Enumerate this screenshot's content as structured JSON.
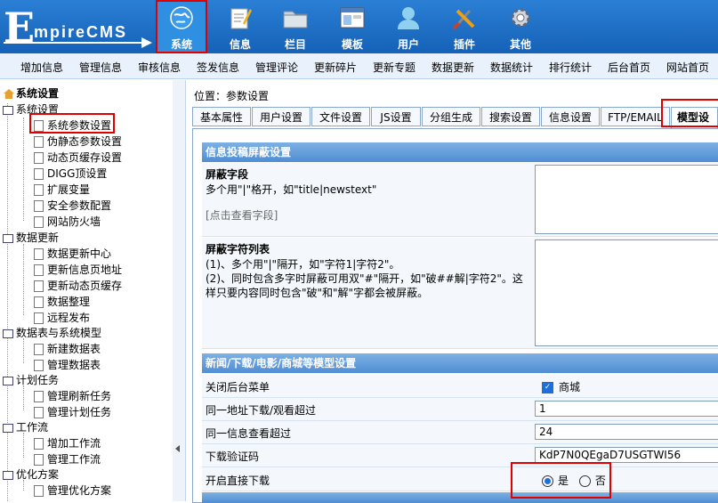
{
  "logo": {
    "first": "E",
    "rest": "mpireCMS"
  },
  "topnav": [
    {
      "label": "系统",
      "icon": "globe-icon"
    },
    {
      "label": "信息",
      "icon": "note-icon"
    },
    {
      "label": "栏目",
      "icon": "folder-icon"
    },
    {
      "label": "模板",
      "icon": "window-icon"
    },
    {
      "label": "用户",
      "icon": "user-icon"
    },
    {
      "label": "插件",
      "icon": "tools-icon"
    },
    {
      "label": "其他",
      "icon": "gear-icon"
    }
  ],
  "subnav": [
    "增加信息",
    "管理信息",
    "审核信息",
    "签发信息",
    "管理评论",
    "更新碎片",
    "更新专题",
    "数据更新",
    "数据统计",
    "排行统计",
    "后台首页",
    "网站首页"
  ],
  "tree": {
    "root": "系统设置",
    "groups": [
      {
        "label": "系统设置",
        "items": [
          "系统参数设置",
          "伪静态参数设置",
          "动态页缓存设置",
          "DIGG顶设置",
          "扩展变量",
          "安全参数配置",
          "网站防火墙"
        ]
      },
      {
        "label": "数据更新",
        "items": [
          "数据更新中心",
          "更新信息页地址",
          "更新动态页缓存",
          "数据整理",
          "远程发布"
        ]
      },
      {
        "label": "数据表与系统模型",
        "items": [
          "新建数据表",
          "管理数据表"
        ]
      },
      {
        "label": "计划任务",
        "items": [
          "管理刷新任务",
          "管理计划任务"
        ]
      },
      {
        "label": "工作流",
        "items": [
          "增加工作流",
          "管理工作流"
        ]
      },
      {
        "label": "优化方案",
        "items": [
          "管理优化方案"
        ]
      }
    ]
  },
  "location": "位置：参数设置",
  "tabs": [
    "基本属性",
    "用户设置",
    "文件设置",
    "JS设置",
    "分组生成",
    "搜索设置",
    "信息设置",
    "FTP/EMAIL",
    "模型设置"
  ],
  "section1": {
    "title": "信息投稿屏蔽设置",
    "field1": {
      "title": "屏蔽字段",
      "desc": "多个用\"|\"格开，如\"title|newstext\"",
      "link": "[点击查看字段]"
    },
    "field2": {
      "title": "屏蔽字符列表",
      "desc1": "(1)、多个用\"|\"隔开，如\"字符1|字符2\"。",
      "desc2": "(2)、同时包含多字时屏蔽可用双\"#\"隔开，如\"破##解|字符2\"。这样只要内容同时包含\"破\"和\"解\"字都会被屏蔽。"
    }
  },
  "section2": {
    "title": "新闻/下载/电影/商城等模型设置",
    "rows": [
      {
        "label": "关闭后台菜单",
        "value": "商城"
      },
      {
        "label": "同一地址下载/观看超过",
        "value": "1"
      },
      {
        "label": "同一信息查看超过",
        "value": "24"
      },
      {
        "label": "下载验证码",
        "value": "KdP7N0QEgaD7USGTWI56"
      },
      {
        "label": "开启直接下载",
        "yes": "是",
        "no": "否"
      }
    ]
  }
}
